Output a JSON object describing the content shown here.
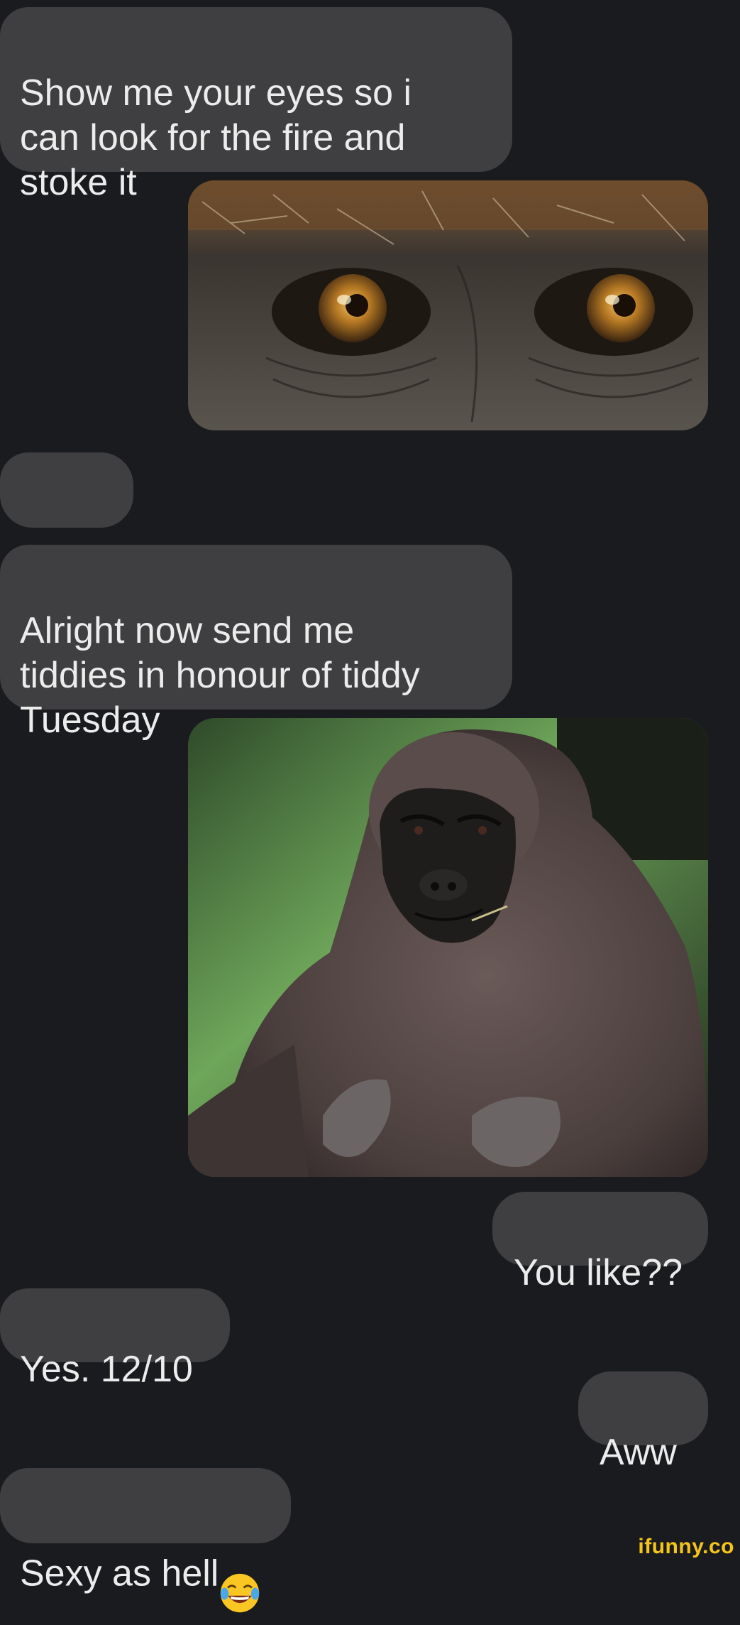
{
  "conversation": {
    "messages": [
      {
        "id": "m1",
        "side": "incoming",
        "text": "Show me your eyes so i\ncan look for the fire and\nstoke it"
      },
      {
        "id": "m2",
        "side": "outgoing",
        "type": "image",
        "image_subject": "close-up of ape eyes",
        "icon": "ape-eyes-photo"
      },
      {
        "id": "m3",
        "side": "incoming",
        "type": "emoji",
        "emoji": [
          "😂",
          "😂"
        ]
      },
      {
        "id": "m4",
        "side": "incoming",
        "text": "Alright now send me\ntiddies in honour of tiddy\nTuesday"
      },
      {
        "id": "m5",
        "side": "outgoing",
        "type": "image",
        "image_subject": "female gorilla photo",
        "icon": "gorilla-photo"
      },
      {
        "id": "m6",
        "side": "outgoing",
        "text": "You like??"
      },
      {
        "id": "m7",
        "side": "incoming",
        "text": "Yes. 12/10"
      },
      {
        "id": "m8",
        "side": "outgoing",
        "text": "Aww"
      },
      {
        "id": "m9",
        "side": "incoming",
        "text": "Sexy as hell",
        "trailing_emoji": "😂"
      }
    ]
  },
  "watermark": {
    "text": "ifunny.co"
  },
  "colors": {
    "background": "#1a1b1f",
    "bubble": "#3f3f41",
    "text": "#ececec",
    "watermark": "#f5c518"
  }
}
